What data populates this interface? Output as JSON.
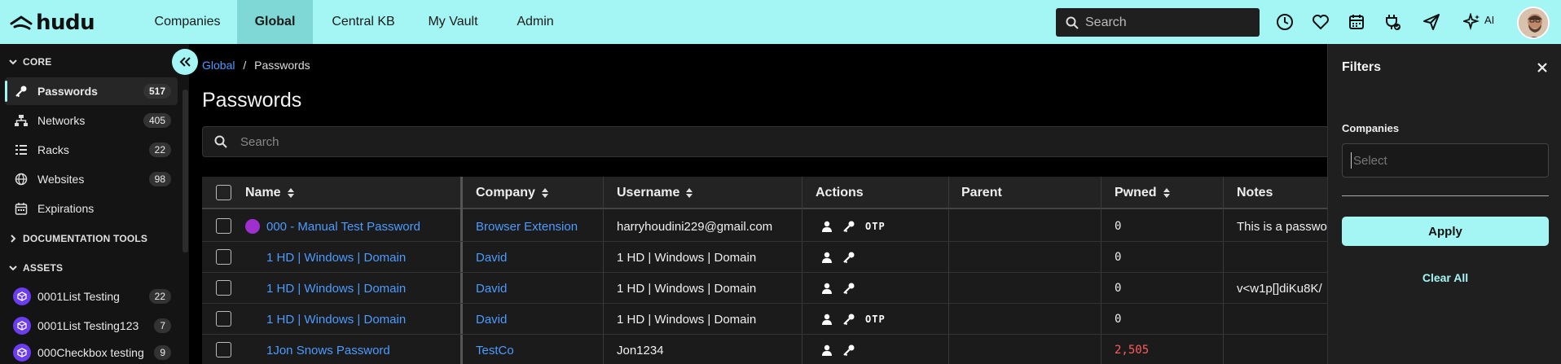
{
  "brand": {
    "name": "hudu"
  },
  "nav": {
    "items": [
      {
        "label": "Companies"
      },
      {
        "label": "Global"
      },
      {
        "label": "Central KB"
      },
      {
        "label": "My Vault"
      },
      {
        "label": "Admin"
      }
    ],
    "search_placeholder": "Search",
    "ai_label": "AI"
  },
  "sidebar": {
    "sections": {
      "core": "CORE",
      "doc_tools": "DOCUMENTATION TOOLS",
      "assets": "ASSETS"
    },
    "core_items": [
      {
        "label": "Passwords",
        "count": "517"
      },
      {
        "label": "Networks",
        "count": "405"
      },
      {
        "label": "Racks",
        "count": "22"
      },
      {
        "label": "Websites",
        "count": "98"
      },
      {
        "label": "Expirations",
        "count": ""
      }
    ],
    "asset_items": [
      {
        "label": "0001List Testing",
        "count": "22"
      },
      {
        "label": "0001List Testing123",
        "count": "7"
      },
      {
        "label": "000Checkbox testing",
        "count": "9"
      }
    ]
  },
  "breadcrumb": {
    "root": "Global",
    "separator": "/",
    "current": "Passwords"
  },
  "page": {
    "title": "Passwords",
    "search_placeholder": "Search"
  },
  "table": {
    "headers": {
      "name": "Name",
      "company": "Company",
      "username": "Username",
      "actions": "Actions",
      "parent": "Parent",
      "pwned": "Pwned",
      "notes": "Notes"
    },
    "otp_label": "OTP",
    "rows": [
      {
        "name": "000 - Manual Test Password",
        "company": "Browser Extension",
        "username": "harryhoudini229@gmail.com",
        "parent": "",
        "pwned": "0",
        "notes": "This is a passwo",
        "otp": true,
        "dot": true
      },
      {
        "name": "1 HD | Windows | Domain",
        "company": "David",
        "username": "1 HD | Windows | Domain",
        "parent": "",
        "pwned": "0",
        "notes": "",
        "otp": false,
        "dot": false
      },
      {
        "name": "1 HD | Windows | Domain",
        "company": "David",
        "username": "1 HD | Windows | Domain",
        "parent": "",
        "pwned": "0",
        "notes": "v<w1p[]diKu8K/",
        "otp": false,
        "dot": false
      },
      {
        "name": "1 HD | Windows | Domain",
        "company": "David",
        "username": "1 HD | Windows | Domain",
        "parent": "",
        "pwned": "0",
        "notes": "",
        "otp": true,
        "dot": false
      },
      {
        "name": "1Jon Snows Password",
        "company": "TestCo",
        "username": "Jon1234",
        "parent": "",
        "pwned": "2,505",
        "notes": "",
        "otp": false,
        "dot": false
      }
    ]
  },
  "filters": {
    "title": "Filters",
    "companies_label": "Companies",
    "select_placeholder": "Select",
    "apply_label": "Apply",
    "clear_label": "Clear All"
  },
  "colors": {
    "accent": "#a3f6f4",
    "link": "#4c9bff",
    "pwned_alert": "#ff5c5c",
    "asset_icon": "#6b3cf0"
  }
}
